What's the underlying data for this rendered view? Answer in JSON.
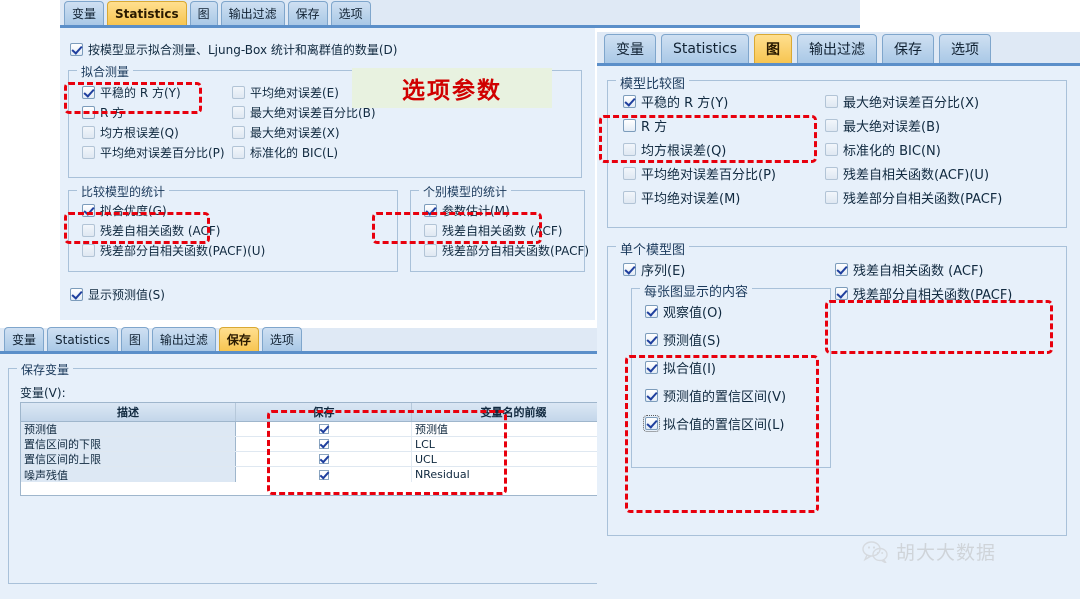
{
  "annotation": {
    "note_text": "选项参数",
    "note_color": "#d00000",
    "note_bg": "#e8f2e0",
    "dash_color": "#e8000d"
  },
  "statistics_dialog": {
    "tabs": [
      {
        "label": "变量",
        "active": false
      },
      {
        "label": "Statistics",
        "active": true
      },
      {
        "label": "图",
        "active": false
      },
      {
        "label": "输出过滤",
        "active": false
      },
      {
        "label": "保存",
        "active": false
      },
      {
        "label": "选项",
        "active": false
      }
    ],
    "top_checkbox": {
      "label": "按模型显示拟合测量、Ljung-Box 统计和离群值的数量(D)",
      "checked": true
    },
    "fit_measures": {
      "group_label": "拟合测量",
      "left_items": [
        {
          "label": "平稳的 R 方(Y)",
          "checked": true,
          "enabled": true
        },
        {
          "label": "R 方",
          "checked": false,
          "enabled": true
        },
        {
          "label": "均方根误差(Q)",
          "checked": false,
          "enabled": false
        },
        {
          "label": "平均绝对误差百分比(P)",
          "checked": false,
          "enabled": false
        }
      ],
      "right_items": [
        {
          "label": "平均绝对误差(E)",
          "checked": false,
          "enabled": false
        },
        {
          "label": "最大绝对误差百分比(B)",
          "checked": false,
          "enabled": false
        },
        {
          "label": "最大绝对误差(X)",
          "checked": false,
          "enabled": false
        },
        {
          "label": "标准化的 BIC(L)",
          "checked": false,
          "enabled": false
        }
      ]
    },
    "compare_models": {
      "group_label": "比较模型的统计",
      "items": [
        {
          "label": "拟合优度(G)",
          "checked": true,
          "enabled": true
        },
        {
          "label": "残差自相关函数 (ACF)",
          "checked": false,
          "enabled": false
        },
        {
          "label": "残差部分自相关函数(PACF)(U)",
          "checked": false,
          "enabled": false
        }
      ]
    },
    "individual_models": {
      "group_label": "个别模型的统计",
      "items": [
        {
          "label": "参数估计(M)",
          "checked": true,
          "enabled": true
        },
        {
          "label": "残差自相关函数 (ACF)",
          "checked": false,
          "enabled": false
        },
        {
          "label": "残差部分自相关函数(PACF)",
          "checked": false,
          "enabled": false
        }
      ]
    },
    "bottom_checkbox": {
      "label": "显示预测值(S)",
      "checked": true
    }
  },
  "save_dialog": {
    "tabs": [
      {
        "label": "变量",
        "active": false
      },
      {
        "label": "Statistics",
        "active": false
      },
      {
        "label": "图",
        "active": false
      },
      {
        "label": "输出过滤",
        "active": false
      },
      {
        "label": "保存",
        "active": true
      },
      {
        "label": "选项",
        "active": false
      }
    ],
    "group_label": "保存变量",
    "variables_label": "变量(V):",
    "table": {
      "headers": [
        "描述",
        "保存",
        "变量名的前缀"
      ],
      "rows": [
        {
          "desc": "预测值",
          "save": true,
          "prefix": "预测值"
        },
        {
          "desc": "置信区间的下限",
          "save": true,
          "prefix": "LCL"
        },
        {
          "desc": "置信区间的上限",
          "save": true,
          "prefix": "UCL"
        },
        {
          "desc": "噪声残值",
          "save": true,
          "prefix": "NResidual"
        }
      ]
    }
  },
  "plots_dialog": {
    "tabs": [
      {
        "label": "变量",
        "active": false
      },
      {
        "label": "Statistics",
        "active": false
      },
      {
        "label": "图",
        "active": true
      },
      {
        "label": "输出过滤",
        "active": false
      },
      {
        "label": "保存",
        "active": false
      },
      {
        "label": "选项",
        "active": false
      }
    ],
    "model_comparison": {
      "group_label": "模型比较图",
      "left_items": [
        {
          "label": "平稳的 R 方(Y)",
          "checked": true,
          "enabled": true
        },
        {
          "label": "R 方",
          "checked": false,
          "enabled": true
        },
        {
          "label": "均方根误差(Q)",
          "checked": false,
          "enabled": false
        },
        {
          "label": "平均绝对误差百分比(P)",
          "checked": false,
          "enabled": false
        },
        {
          "label": "平均绝对误差(M)",
          "checked": false,
          "enabled": false
        }
      ],
      "right_items": [
        {
          "label": "最大绝对误差百分比(X)",
          "checked": false,
          "enabled": false
        },
        {
          "label": "最大绝对误差(B)",
          "checked": false,
          "enabled": false
        },
        {
          "label": "标准化的 BIC(N)",
          "checked": false,
          "enabled": false
        },
        {
          "label": "残差自相关函数(ACF)(U)",
          "checked": false,
          "enabled": false
        },
        {
          "label": "残差部分自相关函数(PACF)",
          "checked": false,
          "enabled": false
        }
      ]
    },
    "single_model": {
      "group_label": "单个模型图",
      "series": {
        "label": "序列(E)",
        "checked": true
      },
      "each_plot": {
        "group_label": "每张图显示的内容",
        "items": [
          {
            "label": "观察值(O)",
            "checked": true
          },
          {
            "label": "预测值(S)",
            "checked": true
          },
          {
            "label": "拟合值(I)",
            "checked": true
          },
          {
            "label": "预测值的置信区间(V)",
            "checked": true
          },
          {
            "label": "拟合值的置信区间(L)",
            "checked": true,
            "focused": true
          }
        ]
      },
      "right_items": [
        {
          "label": "残差自相关函数 (ACF)",
          "checked": true
        },
        {
          "label": "残差部分自相关函数(PACF)",
          "checked": true
        }
      ]
    }
  },
  "watermark": {
    "text": "胡大大数据",
    "icon": "wechat-icon"
  }
}
